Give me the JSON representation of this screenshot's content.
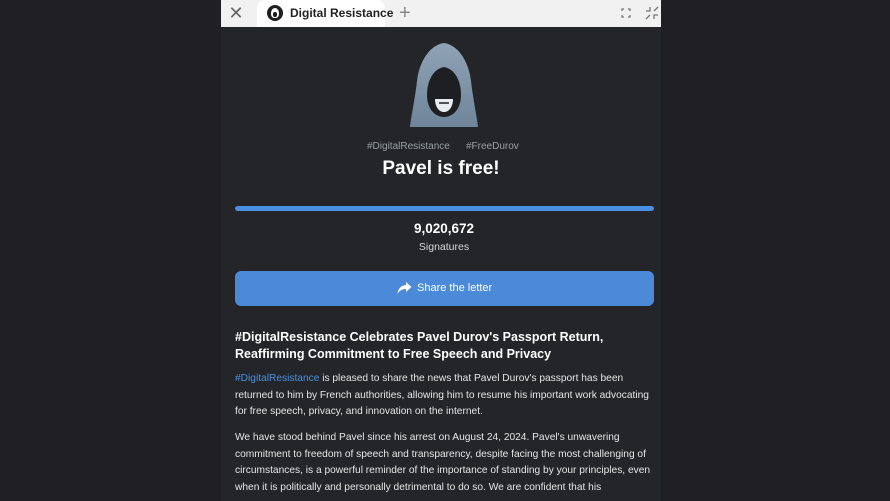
{
  "browser": {
    "tab_title": "Digital Resistance",
    "close_symbol": "✕",
    "new_tab_symbol": "+"
  },
  "page": {
    "hashtags": [
      "#DigitalResistance",
      "#FreeDurov"
    ],
    "title": "Pavel is free!",
    "signature_progress": 1.0,
    "signature_count": "9,020,672",
    "signature_label": "Signatures",
    "share_button": "Share the letter",
    "accent_color": "#4a8ad9"
  },
  "article": {
    "title": "#DigitalResistance Celebrates Pavel Durov's Passport Return, Reaffirming Commitment to Free Speech and Privacy",
    "para1_link": "#DigitalResistance",
    "para1_text": " is pleased to share the news that Pavel Durov's passport has been returned to him by French authorities, allowing him to resume his important work advocating for free speech, privacy, and innovation on the internet.",
    "para2_text": "We have stood behind Pavel since his arrest on August 24, 2024. Pavel's unwavering commitment to freedom of speech and transparency, despite facing the most challenging of circumstances, is a powerful reminder of the importance of standing by your principles, even when it is politically and personally detrimental to do so. We are confident that his"
  }
}
